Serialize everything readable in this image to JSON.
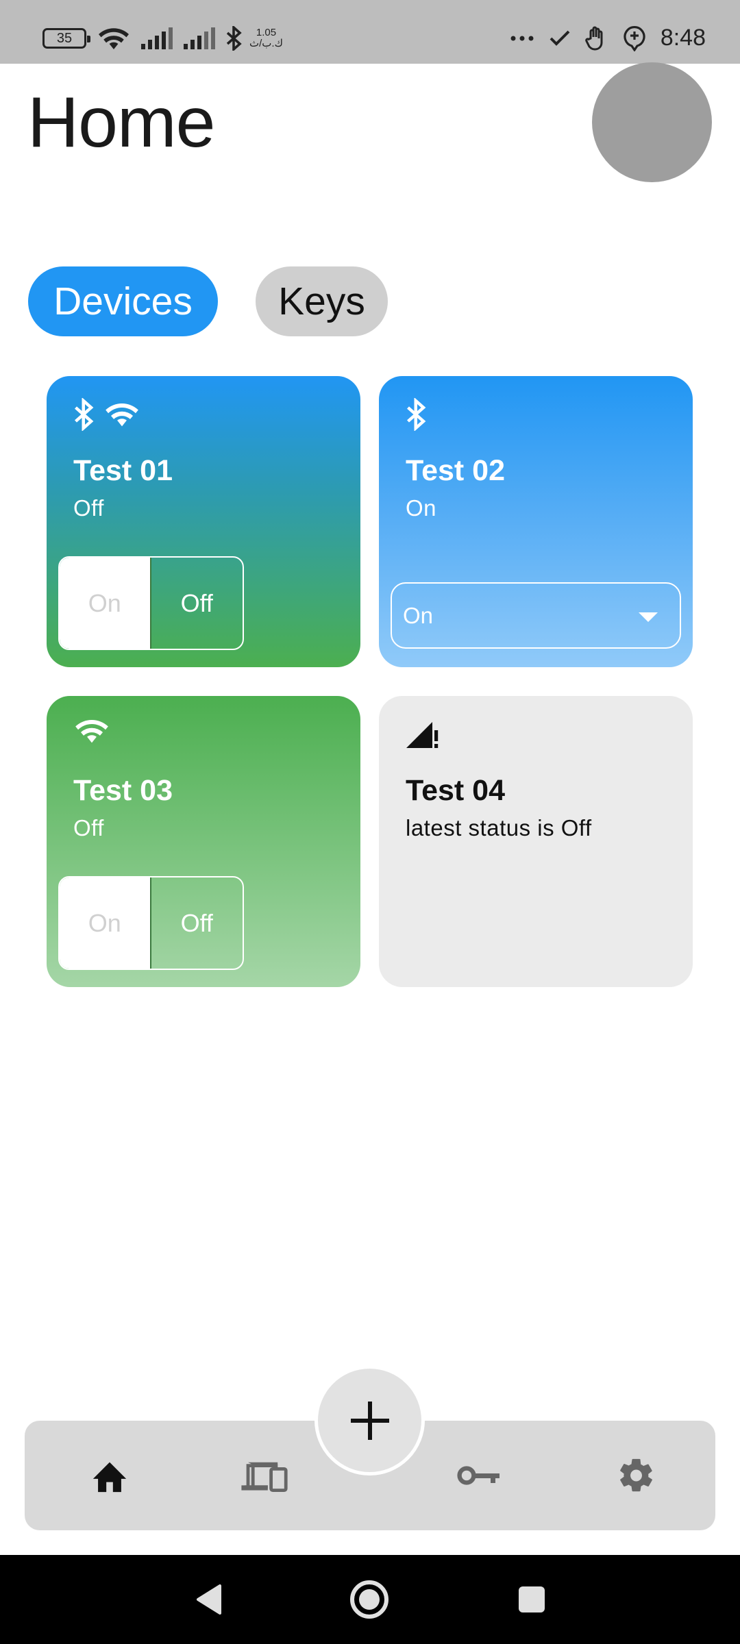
{
  "status_bar": {
    "battery": "35",
    "net_speed_value": "1.05",
    "net_speed_unit": "ك.ب/ث",
    "time": "8:48"
  },
  "header": {
    "title": "Home"
  },
  "tabs": [
    {
      "label": "Devices",
      "selected": true
    },
    {
      "label": "Keys",
      "selected": false
    }
  ],
  "devices": [
    {
      "name": "Test 01",
      "status": "Off",
      "icons": [
        "bluetooth-icon",
        "wifi-icon"
      ],
      "control": "toggle",
      "toggle_on_label": "On",
      "toggle_off_label": "Off"
    },
    {
      "name": "Test 02",
      "status": "On",
      "icons": [
        "bluetooth-icon"
      ],
      "control": "dropdown",
      "dropdown_value": "On"
    },
    {
      "name": "Test 03",
      "status": "Off",
      "icons": [
        "wifi-icon"
      ],
      "control": "toggle",
      "toggle_on_label": "On",
      "toggle_off_label": "Off"
    },
    {
      "name": "Test 04",
      "status": "latest status is Off",
      "icons": [
        "signal-alert-icon"
      ],
      "control": "none"
    }
  ],
  "bottom_nav": {
    "items": [
      "home-icon",
      "devices-icon",
      "key-icon",
      "settings-icon"
    ],
    "fab_icon": "plus-icon"
  },
  "colors": {
    "primary": "#2196f3",
    "green": "#4caf50",
    "light_blue": "#90caf9",
    "card_grey": "#ebebeb"
  }
}
